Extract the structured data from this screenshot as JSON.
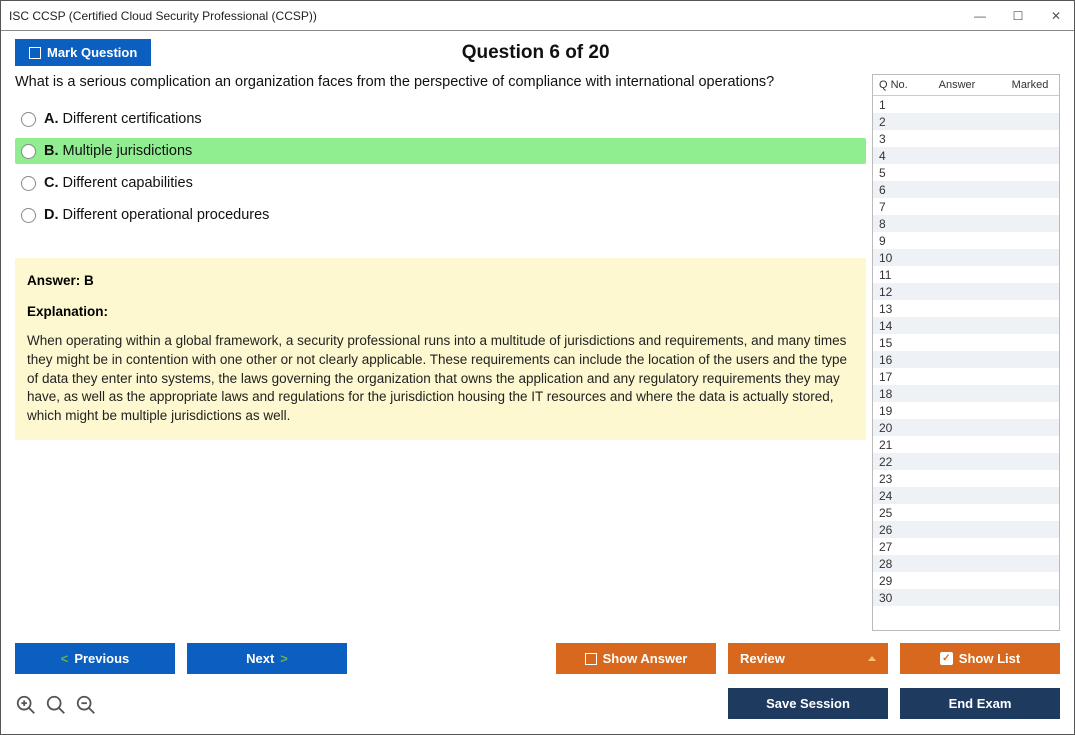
{
  "window": {
    "title": "ISC CCSP (Certified Cloud Security Professional (CCSP))"
  },
  "header": {
    "mark_label": "Mark Question",
    "counter": "Question 6 of 20"
  },
  "question": {
    "text": "What is a serious complication an organization faces from the perspective of compliance with international operations?",
    "options": [
      {
        "letter": "A.",
        "text": "Different certifications",
        "selected": false
      },
      {
        "letter": "B.",
        "text": "Multiple jurisdictions",
        "selected": true
      },
      {
        "letter": "C.",
        "text": "Different capabilities",
        "selected": false
      },
      {
        "letter": "D.",
        "text": "Different operational procedures",
        "selected": false
      }
    ]
  },
  "explanation": {
    "answer_line": "Answer: B",
    "label": "Explanation:",
    "text": "When operating within a global framework, a security professional runs into a multitude of jurisdictions and requirements, and many times they might be in contention with one other or not clearly applicable. These requirements can include the location of the users and the type of data they enter into systems, the laws governing the organization that owns the application and any regulatory requirements they may have, as well as the appropriate laws and regulations for the jurisdiction housing the IT resources and where the data is actually stored, which might be multiple jurisdictions as well."
  },
  "side": {
    "headers": {
      "qno": "Q No.",
      "answer": "Answer",
      "marked": "Marked"
    },
    "rows": [
      1,
      2,
      3,
      4,
      5,
      6,
      7,
      8,
      9,
      10,
      11,
      12,
      13,
      14,
      15,
      16,
      17,
      18,
      19,
      20,
      21,
      22,
      23,
      24,
      25,
      26,
      27,
      28,
      29,
      30
    ]
  },
  "footer": {
    "previous": "Previous",
    "next": "Next",
    "show_answer": "Show Answer",
    "review": "Review",
    "show_list": "Show List",
    "save_session": "Save Session",
    "end_exam": "End Exam"
  }
}
